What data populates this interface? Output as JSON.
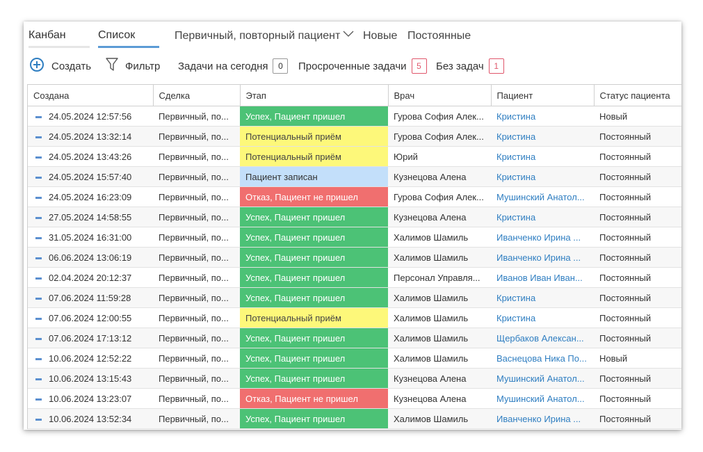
{
  "view_tabs": {
    "kanban": "Канбан",
    "list": "Список"
  },
  "filters": {
    "type_label": "Первичный, повторный пациент",
    "new_label": "Новые",
    "regular_label": "Постоянные"
  },
  "toolbar": {
    "create_label": "Создать",
    "filter_label": "Фильтр",
    "today_label": "Задачи на сегодня",
    "today_count": "0",
    "overdue_label": "Просроченные задачи",
    "overdue_count": "5",
    "no_tasks_label": "Без задач",
    "no_tasks_count": "1"
  },
  "colors": {
    "accent": "#5b9bd5",
    "stage_success": "#4cc276",
    "stage_potential": "#fdf87a",
    "stage_booked": "#c3dffa",
    "stage_refusal": "#f06f6f",
    "link": "#2f7ec1"
  },
  "table": {
    "columns": [
      "Создана",
      "Сделка",
      "Этап",
      "Врач",
      "Пациент",
      "Статус пациента"
    ],
    "rows": [
      {
        "created": "24.05.2024 12:57:56",
        "deal": "Первичный, по...",
        "stage": "Успех, Пациент пришел",
        "stage_kind": "green",
        "doctor": "Гурова София Алек...",
        "patient": "Кристина",
        "status": "Новый"
      },
      {
        "created": "24.05.2024 13:32:14",
        "deal": "Первичный, по...",
        "stage": "Потенциальный приём",
        "stage_kind": "yellow",
        "doctor": "Гурова София Алек...",
        "patient": "Кристина",
        "status": "Постоянный"
      },
      {
        "created": "24.05.2024 13:43:26",
        "deal": "Первичный, по...",
        "stage": "Потенциальный приём",
        "stage_kind": "yellow",
        "doctor": "Юрий",
        "patient": "Кристина",
        "status": "Постоянный"
      },
      {
        "created": "24.05.2024 15:57:40",
        "deal": "Первичный, по...",
        "stage": "Пациент записан",
        "stage_kind": "blue",
        "doctor": "Кузнецова Алена",
        "patient": "Кристина",
        "status": "Постоянный"
      },
      {
        "created": "24.05.2024 16:23:09",
        "deal": "Первичный, по...",
        "stage": "Отказ, Пациент не пришел",
        "stage_kind": "red",
        "doctor": "Гурова София Алек...",
        "patient": "Мушинский Анатол...",
        "status": "Постоянный"
      },
      {
        "created": "27.05.2024 14:58:55",
        "deal": "Первичный, по...",
        "stage": "Успех, Пациент пришел",
        "stage_kind": "green",
        "doctor": "Кузнецова Алена",
        "patient": "Кристина",
        "status": "Постоянный"
      },
      {
        "created": "31.05.2024 16:31:00",
        "deal": "Первичный, по...",
        "stage": "Успех, Пациент пришел",
        "stage_kind": "green",
        "doctor": "Халимов Шамиль",
        "patient": "Иванченко Ирина ...",
        "status": "Постоянный"
      },
      {
        "created": "06.06.2024 13:06:19",
        "deal": "Первичный, по...",
        "stage": "Успех, Пациент пришел",
        "stage_kind": "green",
        "doctor": "Халимов Шамиль",
        "patient": "Иванченко Ирина ...",
        "status": "Постоянный"
      },
      {
        "created": "02.04.2024 20:12:37",
        "deal": "Первичный, по...",
        "stage": "Успех, Пациент пришел",
        "stage_kind": "green",
        "doctor": "Персонал Управля...",
        "patient": "Иванов Иван Иван...",
        "status": "Постоянный"
      },
      {
        "created": "07.06.2024 11:59:28",
        "deal": "Первичный, по...",
        "stage": "Успех, Пациент пришел",
        "stage_kind": "green",
        "doctor": "Халимов Шамиль",
        "patient": "Кристина",
        "status": "Постоянный"
      },
      {
        "created": "07.06.2024 12:00:55",
        "deal": "Первичный, по...",
        "stage": "Потенциальный приём",
        "stage_kind": "yellow",
        "doctor": "Халимов Шамиль",
        "patient": "Кристина",
        "status": "Постоянный"
      },
      {
        "created": "07.06.2024 17:13:12",
        "deal": "Первичный, по...",
        "stage": "Успех, Пациент пришел",
        "stage_kind": "green",
        "doctor": "Халимов Шамиль",
        "patient": "Щербаков Алексан...",
        "status": "Постоянный"
      },
      {
        "created": "10.06.2024 12:52:22",
        "deal": "Первичный, по...",
        "stage": "Успех, Пациент пришел",
        "stage_kind": "green",
        "doctor": "Халимов Шамиль",
        "patient": "Васнецова Ника По...",
        "status": "Новый"
      },
      {
        "created": "10.06.2024 13:15:43",
        "deal": "Первичный, по...",
        "stage": "Успех, Пациент пришел",
        "stage_kind": "green",
        "doctor": "Кузнецова Алена",
        "patient": "Мушинский Анатол...",
        "status": "Постоянный"
      },
      {
        "created": "10.06.2024 13:23:07",
        "deal": "Первичный, по...",
        "stage": "Отказ, Пациент не пришел",
        "stage_kind": "red",
        "doctor": "Кузнецова Алена",
        "patient": "Мушинский Анатол...",
        "status": "Постоянный"
      },
      {
        "created": "10.06.2024 13:52:34",
        "deal": "Первичный, по...",
        "stage": "Успех, Пациент пришел",
        "stage_kind": "green",
        "doctor": "Халимов Шамиль",
        "patient": "Иванченко Ирина ...",
        "status": "Постоянный"
      }
    ]
  }
}
